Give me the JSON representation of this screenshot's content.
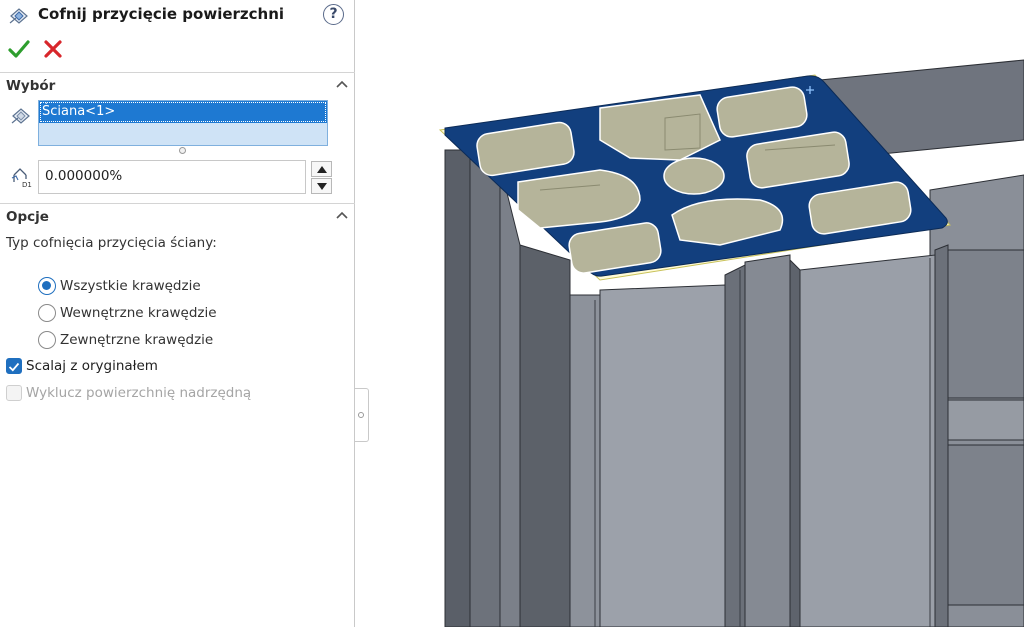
{
  "header": {
    "title": "Cofnij przycięcie powierzchni",
    "help_label": "?",
    "ok_icon": "checkmark-icon",
    "cancel_icon": "x-icon"
  },
  "selection": {
    "section_label": "Wybór",
    "items": [
      "Ściana<1>"
    ],
    "distance_value": "0.000000%"
  },
  "options": {
    "section_label": "Opcje",
    "type_label": "Typ cofnięcia przycięcia ściany:",
    "radios": [
      {
        "label": "Wszystkie krawędzie",
        "selected": true
      },
      {
        "label": "Wewnętrzne krawędzie",
        "selected": false
      },
      {
        "label": "Zewnętrzne krawędzie",
        "selected": false
      }
    ],
    "checkboxes": [
      {
        "label": "Scalaj z oryginałem",
        "checked": true,
        "enabled": true
      },
      {
        "label": "Wyklucz powierzchnię nadrzędną",
        "checked": false,
        "enabled": false
      }
    ]
  },
  "colors": {
    "ok_green": "#2e9e2e",
    "cancel_red": "#d8262b",
    "selection_blue": "#1e79d2",
    "highlight_face": "#123f7e",
    "model_gray": "#8e939d"
  }
}
